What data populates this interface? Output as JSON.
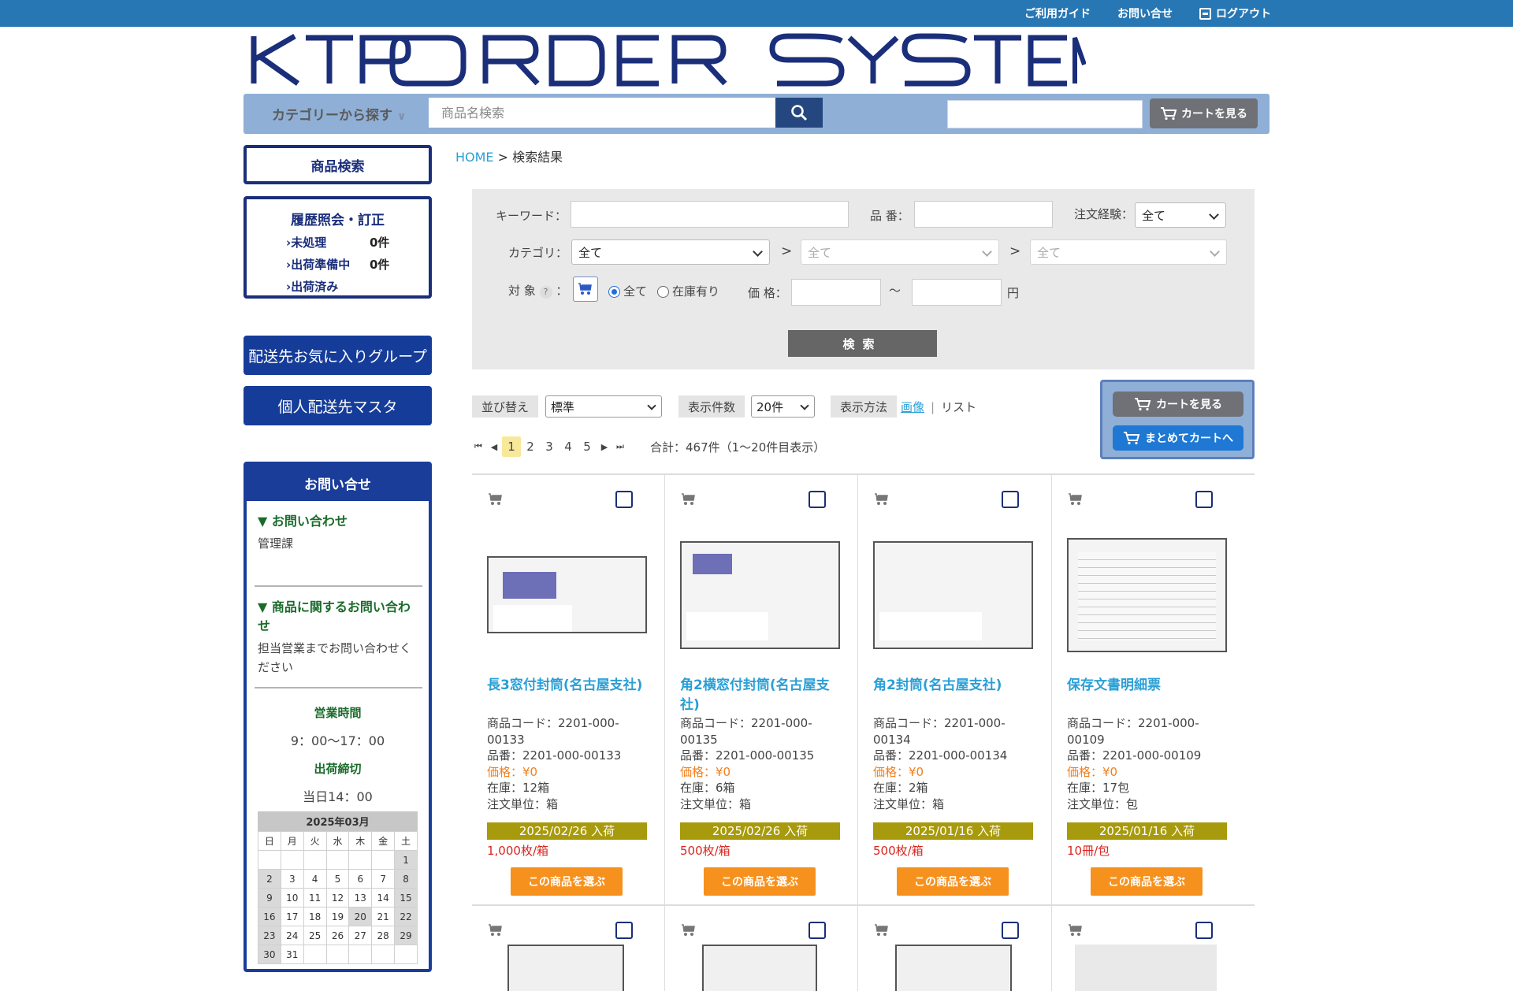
{
  "topbar": {
    "guide": "ご利用ガイド",
    "contact": "お問い合せ",
    "logout": "ログアウト"
  },
  "logo": {
    "text": "KTP ORDER SYSTEM"
  },
  "searchbar": {
    "category_label": "カテゴリーから探す",
    "search_placeholder": "商品名検索",
    "cart_label": "カートを見る"
  },
  "sidebar": {
    "product_search": "商品検索",
    "history": {
      "title": "履歴照会・訂正",
      "rows": [
        {
          "label": "未処理",
          "count": "0件"
        },
        {
          "label": "出荷準備中",
          "count": "0件"
        },
        {
          "label": "出荷済み",
          "count": ""
        }
      ]
    },
    "nav_favorite_group": "配送先お気に入りグループ",
    "nav_personal_master": "個人配送先マスタ",
    "contact": {
      "title": "お問い合せ",
      "sec1_title": "お問い合わせ",
      "sec1_body": "管理課",
      "sec2_title": "商品に関するお問い合わせ",
      "sec2_body": "担当営業までお問い合わせください",
      "hours_title": "営業時間",
      "hours_value": "9：00～17：00",
      "cutoff_title": "出荷締切",
      "cutoff_value": "当日14：00"
    },
    "calendar": {
      "month": "2025年03月",
      "weekdays": [
        "日",
        "月",
        "火",
        "水",
        "木",
        "金",
        "土"
      ],
      "weeks": [
        [
          "",
          "",
          "",
          "",
          "",
          "",
          "1"
        ],
        [
          "2",
          "3",
          "4",
          "5",
          "6",
          "7",
          "8"
        ],
        [
          "9",
          "10",
          "11",
          "12",
          "13",
          "14",
          "15"
        ],
        [
          "16",
          "17",
          "18",
          "19",
          "20",
          "21",
          "22"
        ],
        [
          "23",
          "24",
          "25",
          "26",
          "27",
          "28",
          "29"
        ],
        [
          "30",
          "31",
          "",
          "",
          "",
          "",
          ""
        ]
      ],
      "holidays": [
        "1",
        "2",
        "8",
        "9",
        "15",
        "16",
        "20",
        "22",
        "23",
        "29",
        "30"
      ]
    }
  },
  "breadcrumb": {
    "home": "HOME",
    "sep": ">",
    "current": "検索結果"
  },
  "form": {
    "keyword_label": "キーワード：",
    "partno_label": "品 番：",
    "history_label": "注文経験：",
    "history_value": "全て",
    "category_label": "カテゴリ：",
    "cat1": "全て",
    "cat2": "全て",
    "cat3": "全て",
    "gt": ">",
    "target_label": "対 象",
    "help": "?",
    "colon": "：",
    "radio_all": "全て",
    "radio_stock": "在庫有り",
    "price_label": "価 格：",
    "tilde": "～",
    "yen": "円",
    "search_btn": "検索"
  },
  "listing": {
    "sort_label": "並び替え",
    "sort_value": "標準",
    "count_label": "表示件数",
    "count_value": "20件",
    "view_label": "表示方法",
    "view_image": "画像",
    "view_sep": "|",
    "view_list": "リスト",
    "pages": [
      "1",
      "2",
      "3",
      "4",
      "5"
    ],
    "total": "合計：467件（1～20件目表示）",
    "cart_view": "カートを見る",
    "cart_bulk": "まとめてカートへ"
  },
  "products": [
    {
      "name": "長3窓付封筒(名古屋支社)",
      "code": "商品コード：2201-000-00133",
      "partno": "品番：2201-000-00133",
      "price": "価格：¥0",
      "stock": "在庫：12箱",
      "order_unit": "注文単位：箱",
      "arrival": "2025/02/26 入荷",
      "pack": "1,000枚/箱",
      "select": "この商品を選ぶ"
    },
    {
      "name": "角2横窓付封筒(名古屋支社)",
      "code": "商品コード：2201-000-00135",
      "partno": "品番：2201-000-00135",
      "price": "価格：¥0",
      "stock": "在庫：6箱",
      "order_unit": "注文単位：箱",
      "arrival": "2025/02/26 入荷",
      "pack": "500枚/箱",
      "select": "この商品を選ぶ"
    },
    {
      "name": "角2封筒(名古屋支社)",
      "code": "商品コード：2201-000-00134",
      "partno": "品番：2201-000-00134",
      "price": "価格：¥0",
      "stock": "在庫：2箱",
      "order_unit": "注文単位：箱",
      "arrival": "2025/01/16 入荷",
      "pack": "500枚/箱",
      "select": "この商品を選ぶ"
    },
    {
      "name": "保存文書明細票",
      "code": "商品コード：2201-000-00109",
      "partno": "品番：2201-000-00109",
      "price": "価格：¥0",
      "stock": "在庫：17包",
      "order_unit": "注文単位：包",
      "arrival": "2025/01/16 入荷",
      "pack": "10冊/包",
      "select": "この商品を選ぶ"
    }
  ],
  "colors": {
    "topbar": "#2777b4",
    "navy": "#1a2e7a",
    "link": "#2a9fd6",
    "orange": "#f7911e",
    "arrival": "#a89a0d"
  }
}
